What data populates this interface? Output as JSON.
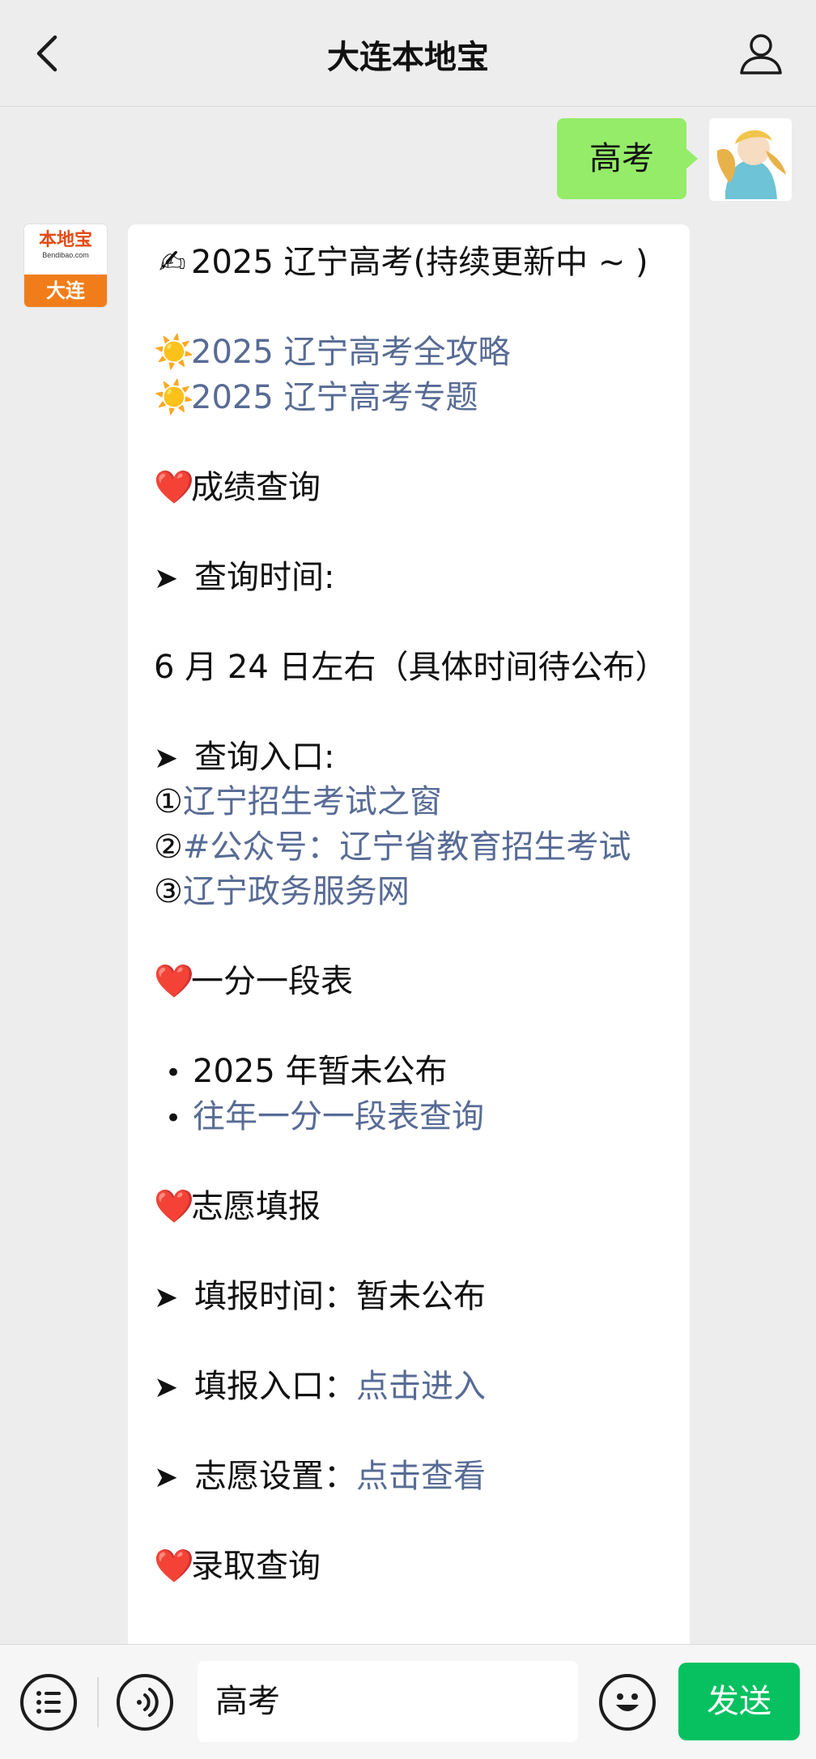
{
  "header": {
    "title": "大连本地宝",
    "back_icon": "chevron-left-icon",
    "profile_icon": "person-icon"
  },
  "user_message": {
    "text": "高考"
  },
  "bot": {
    "logo_main": "本地宝",
    "logo_sub": "Bendibao.com",
    "logo_city": "大连"
  },
  "message": {
    "title_emoji": "✍",
    "title": "2025 辽宁高考(持续更新中 ~ )",
    "sun_emoji": "☀️",
    "links_top": [
      "2025 辽宁高考全攻略",
      "2025 辽宁高考专题"
    ],
    "heart_emoji": "❤️",
    "arrow": "➤",
    "section1_title": "成绩查询",
    "query_time_label": "查询时间:",
    "query_time_value": "6 月 24 日左右（具体时间待公布）",
    "query_entry_label": "查询入口:",
    "entries": [
      {
        "num": "①",
        "prefix": "",
        "label": "辽宁招生考试之窗"
      },
      {
        "num": "②",
        "prefix": "#",
        "label": "公众号：辽宁省教育招生考试"
      },
      {
        "num": "③",
        "prefix": "",
        "label": "辽宁政务服务网"
      }
    ],
    "section2_title": "一分一段表",
    "bullet": "•",
    "score_item1": "2025 年暂未公布",
    "score_item2_link": "往年一分一段表查询",
    "section3_title": "志愿填报",
    "fill_time_label": "填报时间：",
    "fill_time_value": "暂未公布",
    "fill_entry_label": "填报入口：",
    "fill_entry_link": "点击进入",
    "wish_setting_label": "志愿设置：",
    "wish_setting_link": "点击查看",
    "section4_title": "录取查询"
  },
  "input_bar": {
    "menu_icon": "list-menu-icon",
    "voice_icon": "voice-icon",
    "input_value": "高考",
    "emoji_icon": "smiley-icon",
    "send_label": "发送"
  },
  "colors": {
    "background": "#ededed",
    "user_bubble": "#95ec69",
    "link": "#576b95",
    "send_button": "#07c160",
    "logo_orange": "#f07d1a"
  }
}
